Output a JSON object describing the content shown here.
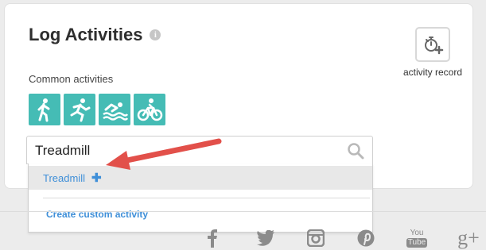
{
  "header": {
    "title": "Log Activities",
    "info_icon": "info-icon",
    "info_glyph": "i"
  },
  "common": {
    "label": "Common activities",
    "activities": [
      {
        "icon": "walking-icon"
      },
      {
        "icon": "running-icon"
      },
      {
        "icon": "swimming-icon"
      },
      {
        "icon": "cycling-icon"
      }
    ]
  },
  "record": {
    "label": "activity record",
    "icon": "stopwatch-plus-icon"
  },
  "search": {
    "value": "Treadmill",
    "icon": "search-icon"
  },
  "dropdown": {
    "suggestion_label": "Treadmill",
    "suggestion_glyph": "✚",
    "custom_label": "Create custom activity"
  },
  "footer": {
    "social_icons": [
      "facebook-icon",
      "twitter-icon",
      "instagram-icon",
      "pinterest-icon",
      "youtube-icon",
      "google-plus-icon"
    ],
    "youtube_top": "You",
    "youtube_bottom": "Tube",
    "gplus_text": "g+"
  },
  "colors": {
    "accent": "#45bcb5",
    "link": "#3f8fd8",
    "annotation_arrow": "#e2504a"
  }
}
